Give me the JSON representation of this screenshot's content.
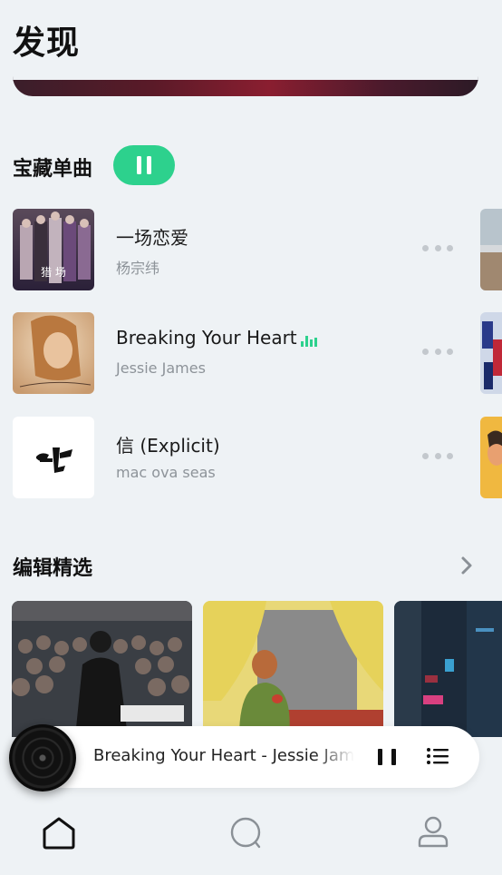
{
  "header": {
    "title": "发现"
  },
  "singles": {
    "title": "宝藏单曲",
    "play_state": "pause-icon",
    "songs": [
      {
        "title": "一场恋爱",
        "artist": "杨宗纬",
        "cover_text": "猎 场"
      },
      {
        "title": "Breaking Your Heart",
        "artist": "Jessie James",
        "playing": true
      },
      {
        "title": "信 (Explicit)",
        "artist": "mac ova seas"
      }
    ]
  },
  "editor": {
    "title": "编辑精选",
    "more_icon": "chevron-right-icon"
  },
  "player": {
    "now_playing": "Breaking Your Heart - Jessie James"
  },
  "tabs": [
    {
      "icon": "home-icon"
    },
    {
      "icon": "search-icon"
    },
    {
      "icon": "profile-icon"
    }
  ],
  "colors": {
    "accent": "#2dd18d",
    "background": "#eef2f5"
  }
}
